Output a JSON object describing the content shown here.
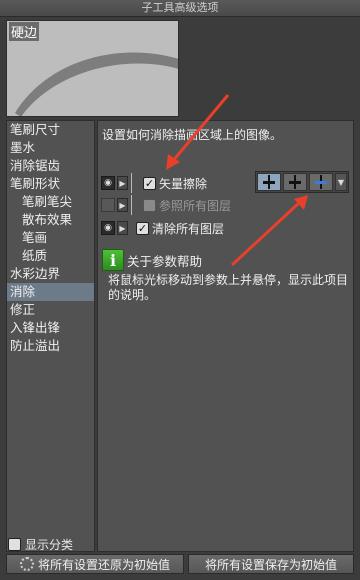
{
  "window": {
    "title": "子工具高级选项"
  },
  "preview": {
    "label": "硬边"
  },
  "sidebar": {
    "items": [
      {
        "label": "笔刷尺寸",
        "sub": false,
        "selected": false
      },
      {
        "label": "墨水",
        "sub": false,
        "selected": false
      },
      {
        "label": "消除锯齿",
        "sub": false,
        "selected": false
      },
      {
        "label": "笔刷形状",
        "sub": false,
        "selected": false
      },
      {
        "label": "笔刷笔尖",
        "sub": true,
        "selected": false
      },
      {
        "label": "散布效果",
        "sub": true,
        "selected": false
      },
      {
        "label": "笔画",
        "sub": true,
        "selected": false
      },
      {
        "label": "纸质",
        "sub": true,
        "selected": false
      },
      {
        "label": "水彩边界",
        "sub": false,
        "selected": false
      },
      {
        "label": "消除",
        "sub": false,
        "selected": true
      },
      {
        "label": "修正",
        "sub": false,
        "selected": false
      },
      {
        "label": "入锋出锋",
        "sub": false,
        "selected": false
      },
      {
        "label": "防止溢出",
        "sub": false,
        "selected": false
      }
    ],
    "show_category": {
      "label": "显示分类",
      "checked": false
    }
  },
  "content": {
    "description": "设置如何消除描画区域上的图像。",
    "vector_erase": {
      "label": "矢量擦除",
      "checked": true
    },
    "reference_all_layers": {
      "label": "参照所有图层",
      "checked": false
    },
    "erase_all_layers": {
      "label": "清除所有图层",
      "checked": true
    },
    "help": {
      "title": "关于参数帮助",
      "body": "将鼠标光标移动到参数上并悬停，显示此项目的说明。"
    }
  },
  "buttons": {
    "reset": "将所有设置还原为初始值",
    "save": "将所有设置保存为初始值"
  },
  "colors": {
    "accent": "#6d7a8a",
    "arrow": "#e8402a",
    "help_icon": "#3aa52a"
  }
}
